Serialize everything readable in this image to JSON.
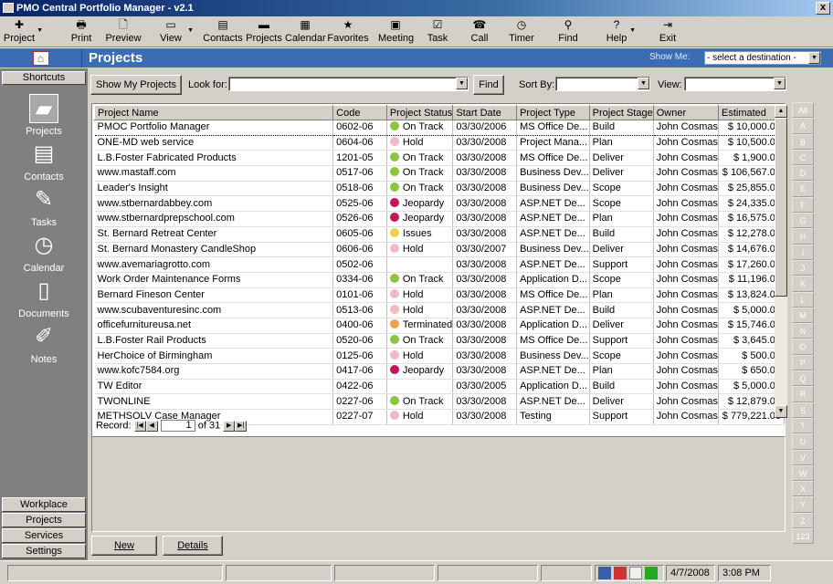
{
  "window": {
    "title": "PMO Central Portfolio Manager - v2.1",
    "close": "x"
  },
  "toolbar": [
    {
      "label": "Project",
      "icon": "plus-icon",
      "glyph": "✚"
    },
    {
      "label": "Print",
      "icon": "printer-icon",
      "glyph": "🖶"
    },
    {
      "label": "Preview",
      "icon": "preview-icon",
      "glyph": "🗋"
    },
    {
      "label": "View",
      "icon": "view-icon",
      "glyph": "▭"
    },
    {
      "label": "Contacts",
      "icon": "contacts-icon",
      "glyph": "▤"
    },
    {
      "label": "Projects",
      "icon": "folder-icon",
      "glyph": "▬"
    },
    {
      "label": "Calendar",
      "icon": "calendar-icon",
      "glyph": "▦"
    },
    {
      "label": "Favorites",
      "icon": "favorites-icon",
      "glyph": "★"
    },
    {
      "label": "Meeting",
      "icon": "meeting-icon",
      "glyph": "▣"
    },
    {
      "label": "Task",
      "icon": "task-icon",
      "glyph": "☑"
    },
    {
      "label": "Call",
      "icon": "phone-icon",
      "glyph": "☎"
    },
    {
      "label": "Timer",
      "icon": "clock-icon",
      "glyph": "◷"
    },
    {
      "label": "Find",
      "icon": "binoculars-icon",
      "glyph": "⚲"
    },
    {
      "label": "Help",
      "icon": "help-icon",
      "glyph": "?"
    },
    {
      "label": "Exit",
      "icon": "exit-icon",
      "glyph": "⇥"
    }
  ],
  "banner": {
    "title": "Projects",
    "show_me": "Show Me:",
    "destination": "- select a destination -"
  },
  "sidebar": {
    "header": "Shortcuts",
    "items": [
      {
        "label": "Projects",
        "icon": "projects-icon",
        "glyph": "▰"
      },
      {
        "label": "Contacts",
        "icon": "contacts-card-icon",
        "glyph": "▤"
      },
      {
        "label": "Tasks",
        "icon": "tasks-icon",
        "glyph": "✎"
      },
      {
        "label": "Calendar",
        "icon": "calendar-clock-icon",
        "glyph": "◷"
      },
      {
        "label": "Documents",
        "icon": "documents-icon",
        "glyph": "▯"
      },
      {
        "label": "Notes",
        "icon": "notes-icon",
        "glyph": "✐"
      }
    ],
    "bottom": [
      "Workplace",
      "Projects",
      "Services",
      "Settings"
    ]
  },
  "filter": {
    "show_my": "Show My Projects",
    "look_for": "Look for:",
    "find": "Find",
    "sort_by": "Sort By:",
    "view": "View:"
  },
  "columns": [
    "Project Name",
    "Code",
    "Project Status",
    "Start Date",
    "Project Type",
    "Project Stage",
    "Owner",
    "Estimated"
  ],
  "rows": [
    [
      "PMOC Portfolio Manager",
      "0602-06",
      "On Track",
      "03/30/2006",
      "MS Office De...",
      "Build",
      "John Cosmas",
      "$ 10,000.00"
    ],
    [
      "ONE-MD web service",
      "0604-06",
      "Hold",
      "03/30/2008",
      "Project Mana...",
      "Plan",
      "John Cosmas",
      "$ 10,500.00"
    ],
    [
      "L.B.Foster Fabricated Products",
      "1201-05",
      "On Track",
      "03/30/2008",
      "MS Office De...",
      "Deliver",
      "John Cosmas",
      "$ 1,900.00"
    ],
    [
      "www.mastaff.com",
      "0517-06",
      "On Track",
      "03/30/2008",
      "Business Dev...",
      "Deliver",
      "John Cosmas",
      "$ 106,567.00"
    ],
    [
      "Leader's Insight",
      "0518-06",
      "On Track",
      "03/30/2008",
      "Business Dev...",
      "Scope",
      "John Cosmas",
      "$ 25,855.00"
    ],
    [
      "www.stbernardabbey.com",
      "0525-06",
      "Jeopardy",
      "03/30/2008",
      "ASP.NET De...",
      "Scope",
      "John Cosmas",
      "$ 24,335.00"
    ],
    [
      "www.stbernardprepschool.com",
      "0526-06",
      "Jeopardy",
      "03/30/2008",
      "ASP.NET De...",
      "Plan",
      "John Cosmas",
      "$ 16,575.00"
    ],
    [
      "St. Bernard Retreat Center",
      "0605-06",
      "Issues",
      "03/30/2008",
      "ASP.NET De...",
      "Build",
      "John Cosmas",
      "$ 12,278.00"
    ],
    [
      "St. Bernard Monastery CandleShop",
      "0606-06",
      "Hold",
      "03/30/2007",
      "Business Dev...",
      "Deliver",
      "John Cosmas",
      "$ 14,676.00"
    ],
    [
      "www.avemariagrotto.com",
      "0502-06",
      "",
      "03/30/2008",
      "ASP.NET De...",
      "Support",
      "John Cosmas",
      "$ 17,260.00"
    ],
    [
      "Work Order Maintenance Forms",
      "0334-06",
      "On Track",
      "03/30/2008",
      "Application D...",
      "Scope",
      "John Cosmas",
      "$ 11,196.00"
    ],
    [
      "Bernard Fineson Center",
      "0101-06",
      "Hold",
      "03/30/2008",
      "MS Office De...",
      "Plan",
      "John Cosmas",
      "$ 13,824.00"
    ],
    [
      "www.scubaventuresinc.com",
      "0513-06",
      "Hold",
      "03/30/2008",
      "ASP.NET De...",
      "Build",
      "John Cosmas",
      "$ 5,000.00"
    ],
    [
      "officefurnitureusa.net",
      "0400-06",
      "Terminated",
      "03/30/2008",
      "Application D...",
      "Deliver",
      "John Cosmas",
      "$ 15,746.00"
    ],
    [
      "L.B.Foster Rail Products",
      "0520-06",
      "On Track",
      "03/30/2008",
      "MS Office De...",
      "Support",
      "John Cosmas",
      "$ 3,645.00"
    ],
    [
      "HerChoice of Birmingham",
      "0125-06",
      "Hold",
      "03/30/2008",
      "Business Dev...",
      "Scope",
      "John Cosmas",
      "$ 500.00"
    ],
    [
      "www.kofc7584.org",
      "0417-06",
      "Jeopardy",
      "03/30/2008",
      "ASP.NET De...",
      "Plan",
      "John Cosmas",
      "$ 650.00"
    ],
    [
      "TW Editor",
      "0422-06",
      "",
      "03/30/2005",
      "Application D...",
      "Build",
      "John Cosmas",
      "$ 5,000.00"
    ],
    [
      "TWONLINE",
      "0227-06",
      "On Track",
      "03/30/2008",
      "ASP.NET De...",
      "Deliver",
      "John Cosmas",
      "$ 12,879.00"
    ],
    [
      "METHSOLV Case Manager",
      "0227-07",
      "Hold",
      "03/30/2008",
      "Testing",
      "Support",
      "John Cosmas",
      "$ 779,221.00"
    ]
  ],
  "status_colors": {
    "On Track": "#8cc63f",
    "Hold": "#f2b8c6",
    "Jeopardy": "#c2185b",
    "Issues": "#f2d04a",
    "Terminated": "#f0a050"
  },
  "record": {
    "label": "Record:",
    "current": "1",
    "of": "of 31"
  },
  "alpha": [
    "All",
    "A",
    "B",
    "C",
    "D",
    "E",
    "F",
    "G",
    "H",
    "I",
    "J",
    "K",
    "L",
    "M",
    "N",
    "O",
    "P",
    "Q",
    "R",
    "S",
    "T",
    "U",
    "V",
    "W",
    "X",
    "Y",
    "Z",
    "123"
  ],
  "bottom_buttons": {
    "new": "New",
    "details": "Details"
  },
  "statusbar": {
    "date": "4/7/2008",
    "time": "3:08 PM"
  }
}
